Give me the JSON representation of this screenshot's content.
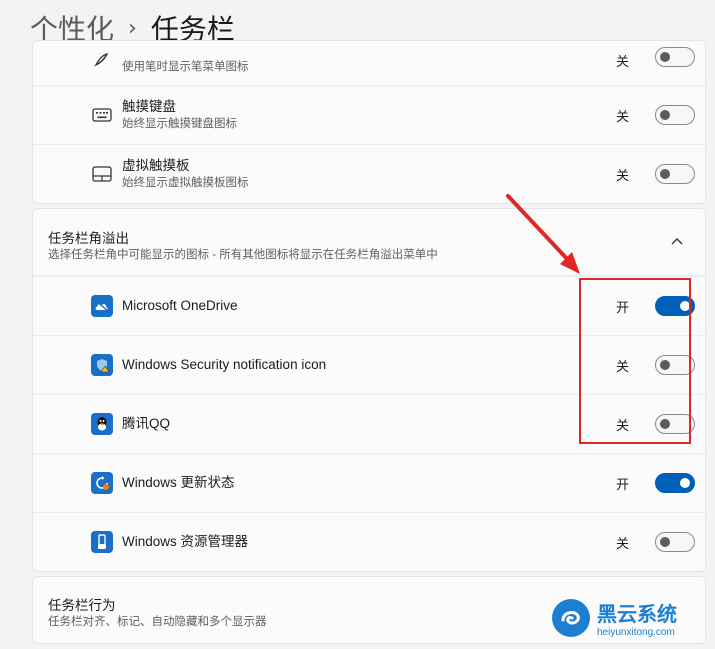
{
  "breadcrumb": {
    "parent": "个性化",
    "separator": "›",
    "current": "任务栏"
  },
  "pen_row": {
    "subtitle": "使用笔时显示笔菜单图标",
    "state": "关",
    "icon": "pen-icon"
  },
  "touch_keyboard": {
    "title": "触摸键盘",
    "subtitle": "始终显示触摸键盘图标",
    "state": "关",
    "icon": "keyboard-icon"
  },
  "virtual_touchpad": {
    "title": "虚拟触摸板",
    "subtitle": "始终显示虚拟触摸板图标",
    "state": "关",
    "icon": "touchpad-icon"
  },
  "overflow_section": {
    "title": "任务栏角溢出",
    "subtitle": "选择任务栏角中可能显示的图标 - 所有其他图标将显示在任务栏角溢出菜单中",
    "items": [
      {
        "label": "Microsoft OneDrive",
        "state": "开",
        "on": true,
        "icon": "onedrive-icon",
        "color": "#1a6fc9"
      },
      {
        "label": "Windows Security notification icon",
        "state": "关",
        "on": false,
        "icon": "windows-security-icon",
        "color": "#1a6fc9"
      },
      {
        "label": "腾讯QQ",
        "state": "关",
        "on": false,
        "icon": "qq-icon",
        "color": "#1a6fc9"
      },
      {
        "label": "Windows 更新状态",
        "state": "开",
        "on": true,
        "icon": "windows-update-icon",
        "color": "#1a6fc9"
      },
      {
        "label": "Windows 资源管理器",
        "state": "关",
        "on": false,
        "icon": "file-explorer-icon",
        "color": "#1a6fc9"
      }
    ]
  },
  "behavior_section": {
    "title": "任务栏行为",
    "subtitle": "任务栏对齐、标记、自动隐藏和多个显示器"
  },
  "watermark": {
    "name": "黑云系统",
    "url": "heiyunxitong.com"
  },
  "colors": {
    "accent": "#005fb8",
    "annotation": "#e02626"
  }
}
